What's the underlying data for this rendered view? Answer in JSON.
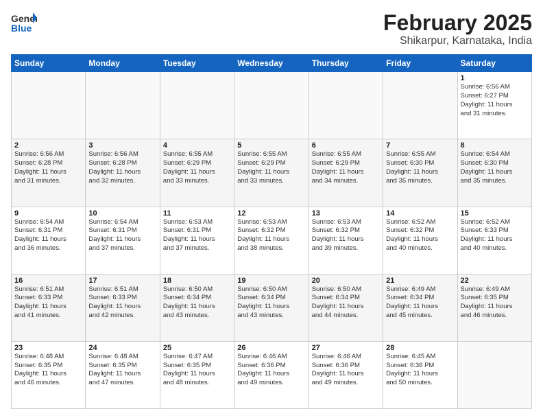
{
  "header": {
    "logo_general": "General",
    "logo_blue": "Blue",
    "title": "February 2025",
    "subtitle": "Shikarpur, Karnataka, India"
  },
  "weekdays": [
    "Sunday",
    "Monday",
    "Tuesday",
    "Wednesday",
    "Thursday",
    "Friday",
    "Saturday"
  ],
  "weeks": [
    [
      {
        "day": "",
        "info": ""
      },
      {
        "day": "",
        "info": ""
      },
      {
        "day": "",
        "info": ""
      },
      {
        "day": "",
        "info": ""
      },
      {
        "day": "",
        "info": ""
      },
      {
        "day": "",
        "info": ""
      },
      {
        "day": "1",
        "info": "Sunrise: 6:56 AM\nSunset: 6:27 PM\nDaylight: 11 hours\nand 31 minutes."
      }
    ],
    [
      {
        "day": "2",
        "info": "Sunrise: 6:56 AM\nSunset: 6:28 PM\nDaylight: 11 hours\nand 31 minutes."
      },
      {
        "day": "3",
        "info": "Sunrise: 6:56 AM\nSunset: 6:28 PM\nDaylight: 11 hours\nand 32 minutes."
      },
      {
        "day": "4",
        "info": "Sunrise: 6:55 AM\nSunset: 6:29 PM\nDaylight: 11 hours\nand 33 minutes."
      },
      {
        "day": "5",
        "info": "Sunrise: 6:55 AM\nSunset: 6:29 PM\nDaylight: 11 hours\nand 33 minutes."
      },
      {
        "day": "6",
        "info": "Sunrise: 6:55 AM\nSunset: 6:29 PM\nDaylight: 11 hours\nand 34 minutes."
      },
      {
        "day": "7",
        "info": "Sunrise: 6:55 AM\nSunset: 6:30 PM\nDaylight: 11 hours\nand 35 minutes."
      },
      {
        "day": "8",
        "info": "Sunrise: 6:54 AM\nSunset: 6:30 PM\nDaylight: 11 hours\nand 35 minutes."
      }
    ],
    [
      {
        "day": "9",
        "info": "Sunrise: 6:54 AM\nSunset: 6:31 PM\nDaylight: 11 hours\nand 36 minutes."
      },
      {
        "day": "10",
        "info": "Sunrise: 6:54 AM\nSunset: 6:31 PM\nDaylight: 11 hours\nand 37 minutes."
      },
      {
        "day": "11",
        "info": "Sunrise: 6:53 AM\nSunset: 6:31 PM\nDaylight: 11 hours\nand 37 minutes."
      },
      {
        "day": "12",
        "info": "Sunrise: 6:53 AM\nSunset: 6:32 PM\nDaylight: 11 hours\nand 38 minutes."
      },
      {
        "day": "13",
        "info": "Sunrise: 6:53 AM\nSunset: 6:32 PM\nDaylight: 11 hours\nand 39 minutes."
      },
      {
        "day": "14",
        "info": "Sunrise: 6:52 AM\nSunset: 6:32 PM\nDaylight: 11 hours\nand 40 minutes."
      },
      {
        "day": "15",
        "info": "Sunrise: 6:52 AM\nSunset: 6:33 PM\nDaylight: 11 hours\nand 40 minutes."
      }
    ],
    [
      {
        "day": "16",
        "info": "Sunrise: 6:51 AM\nSunset: 6:33 PM\nDaylight: 11 hours\nand 41 minutes."
      },
      {
        "day": "17",
        "info": "Sunrise: 6:51 AM\nSunset: 6:33 PM\nDaylight: 11 hours\nand 42 minutes."
      },
      {
        "day": "18",
        "info": "Sunrise: 6:50 AM\nSunset: 6:34 PM\nDaylight: 11 hours\nand 43 minutes."
      },
      {
        "day": "19",
        "info": "Sunrise: 6:50 AM\nSunset: 6:34 PM\nDaylight: 11 hours\nand 43 minutes."
      },
      {
        "day": "20",
        "info": "Sunrise: 6:50 AM\nSunset: 6:34 PM\nDaylight: 11 hours\nand 44 minutes."
      },
      {
        "day": "21",
        "info": "Sunrise: 6:49 AM\nSunset: 6:34 PM\nDaylight: 11 hours\nand 45 minutes."
      },
      {
        "day": "22",
        "info": "Sunrise: 6:49 AM\nSunset: 6:35 PM\nDaylight: 11 hours\nand 46 minutes."
      }
    ],
    [
      {
        "day": "23",
        "info": "Sunrise: 6:48 AM\nSunset: 6:35 PM\nDaylight: 11 hours\nand 46 minutes."
      },
      {
        "day": "24",
        "info": "Sunrise: 6:48 AM\nSunset: 6:35 PM\nDaylight: 11 hours\nand 47 minutes."
      },
      {
        "day": "25",
        "info": "Sunrise: 6:47 AM\nSunset: 6:35 PM\nDaylight: 11 hours\nand 48 minutes."
      },
      {
        "day": "26",
        "info": "Sunrise: 6:46 AM\nSunset: 6:36 PM\nDaylight: 11 hours\nand 49 minutes."
      },
      {
        "day": "27",
        "info": "Sunrise: 6:46 AM\nSunset: 6:36 PM\nDaylight: 11 hours\nand 49 minutes."
      },
      {
        "day": "28",
        "info": "Sunrise: 6:45 AM\nSunset: 6:36 PM\nDaylight: 11 hours\nand 50 minutes."
      },
      {
        "day": "",
        "info": ""
      }
    ]
  ]
}
